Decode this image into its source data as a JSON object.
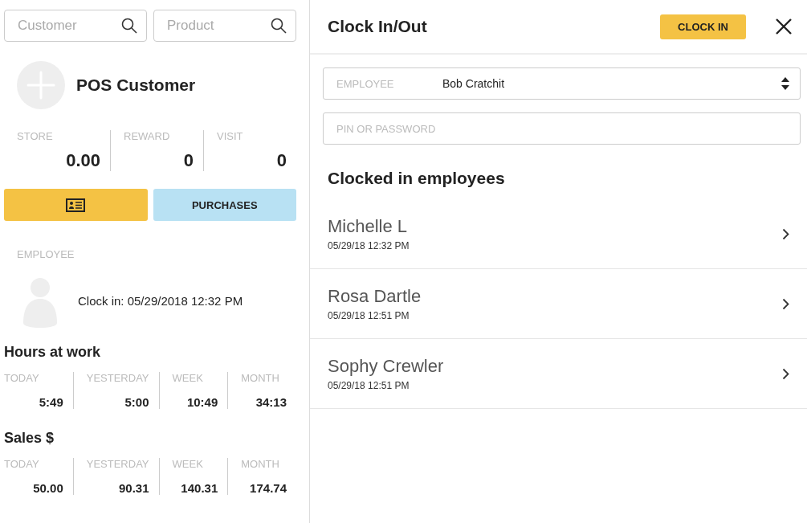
{
  "search": [
    {
      "placeholder": "Customer"
    },
    {
      "placeholder": "Product"
    }
  ],
  "customer": {
    "name": "POS Customer",
    "stats": [
      {
        "label": "STORE",
        "value": "0.00"
      },
      {
        "label": "REWARD",
        "value": "0"
      },
      {
        "label": "VISIT",
        "value": "0"
      }
    ],
    "purchases_button": "PURCHASES"
  },
  "employee": {
    "label": "EMPLOYEE",
    "clock_in": "Clock in: 05/29/2018 12:32 PM"
  },
  "hours": {
    "title": "Hours at work",
    "stats": [
      {
        "label": "TODAY",
        "value": "5:49"
      },
      {
        "label": "YESTERDAY",
        "value": "5:00"
      },
      {
        "label": "WEEK",
        "value": "10:49"
      },
      {
        "label": "MONTH",
        "value": "34:13"
      }
    ]
  },
  "sales": {
    "title": "Sales $",
    "stats": [
      {
        "label": "TODAY",
        "value": "50.00"
      },
      {
        "label": "YESTERDAY",
        "value": "90.31"
      },
      {
        "label": "WEEK",
        "value": "140.31"
      },
      {
        "label": "MONTH",
        "value": "174.74"
      }
    ]
  },
  "dialog": {
    "title": "Clock In/Out",
    "clock_in_button": "CLOCK IN",
    "employee_field": {
      "label": "EMPLOYEE",
      "value": "Bob Cratchit"
    },
    "pin_field": {
      "placeholder": "PIN OR PASSWORD"
    },
    "list_title": "Clocked in employees",
    "employees": [
      {
        "name": "Michelle L",
        "time": "05/29/18 12:32 PM"
      },
      {
        "name": "Rosa Dartle",
        "time": "05/29/18 12:51 PM"
      },
      {
        "name": "Sophy Crewler",
        "time": "05/29/18 12:51 PM"
      }
    ]
  }
}
